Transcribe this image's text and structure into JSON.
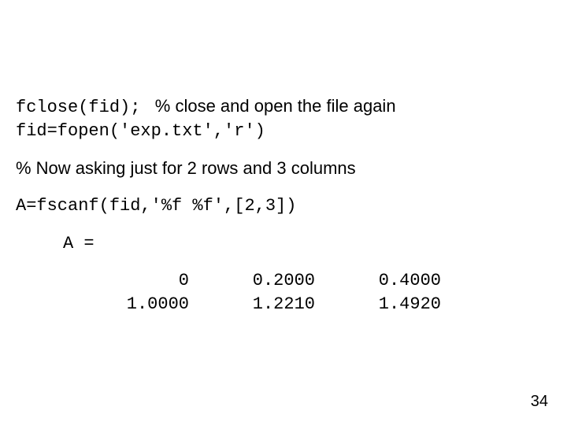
{
  "line1_code": "fclose(fid);",
  "line1_comment": "   % close and open the file again",
  "line2_code": "fid=fopen('exp.txt','r')",
  "comment_rows": "% Now asking just for 2 rows and 3 columns",
  "scan_code": "A=fscanf(fid,'%f %f',[2,3])",
  "out_label": "A =",
  "matrix": {
    "r0c0": "0",
    "r0c1": "0.2000",
    "r0c2": "0.4000",
    "r1c0": "1.0000",
    "r1c1": "1.2210",
    "r1c2": "1.4920"
  },
  "page_number": "34"
}
